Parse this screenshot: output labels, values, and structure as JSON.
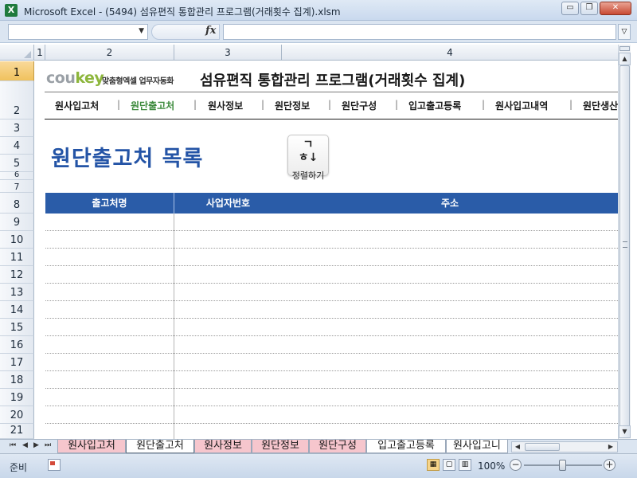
{
  "window": {
    "title": "Microsoft Excel - (5494) 섬유편직 통합관리 프로그램(거래횟수 집계).xlsm",
    "app_icon": "X",
    "minimize": "▭",
    "restore": "❐",
    "close": "✕"
  },
  "formula_bar": {
    "name_box_value": "",
    "fx_label": "fx",
    "formula_value": ""
  },
  "columns": [
    "1",
    "2",
    "3",
    "4"
  ],
  "rows": [
    "1",
    "2",
    "3",
    "4",
    "5",
    "6",
    "7",
    "8",
    "9",
    "10",
    "11",
    "12",
    "13",
    "14",
    "15",
    "16",
    "17",
    "18",
    "19",
    "20",
    "21"
  ],
  "header": {
    "logo_part1": "cou",
    "logo_part2": "key",
    "logo_tagline": "맞춤형엑셀 업무자동화",
    "program_title": "섬유편직 통합관리 프로그램(거래횟수 집계)"
  },
  "menu": {
    "items": [
      "원사입고처",
      "원단출고처",
      "원사정보",
      "원단정보",
      "원단구성",
      "입고출고등록",
      "원사입고내역",
      "원단생산"
    ],
    "separator": "|",
    "active_index": 1
  },
  "page": {
    "section_title": "원단출고처 목록",
    "sort_button_icon": "ㄱ\nㅎ↓",
    "sort_button_label": "정렬하기"
  },
  "table": {
    "headers": [
      "출고처명",
      "사업자번호",
      "주소"
    ],
    "row_count": 13
  },
  "sheet_tabs": {
    "tabs": [
      "원사입고처",
      "원단출고처",
      "원사정보",
      "원단정보",
      "원단구성",
      "입고출고등록",
      "원사입고니"
    ],
    "active_index": 1
  },
  "status_bar": {
    "status": "준비",
    "zoom": "100%",
    "zoom_out": "−",
    "zoom_in": "+"
  },
  "colors": {
    "accent_blue": "#2a5ca8",
    "title_blue": "#2454a6",
    "active_menu_green": "#3c8a3c",
    "tab_pink": "#f6c6cd"
  }
}
